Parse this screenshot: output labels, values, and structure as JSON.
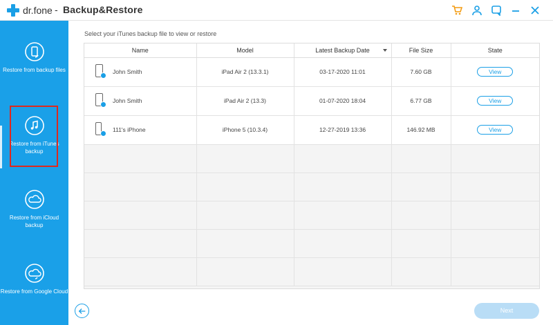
{
  "titlebar": {
    "brand": "dr.fone",
    "separator": "-",
    "title": "Backup&Restore",
    "icons": [
      "cart-icon",
      "user-icon",
      "feedback-icon",
      "minimize-icon",
      "close-icon"
    ]
  },
  "colors": {
    "accent": "#1aa0e8",
    "highlight": "#e0281c",
    "next_disabled": "#b9ddf6"
  },
  "sidebar": {
    "items": [
      {
        "label": "Restore from backup files",
        "icon": "phone-restore-icon"
      },
      {
        "label": "Restore from iTunes backup",
        "icon": "itunes-restore-icon",
        "active": true
      },
      {
        "label": "Restore from iCloud backup",
        "icon": "icloud-icon"
      },
      {
        "label": "Restore from Google Cloud",
        "icon": "google-cloud-icon"
      }
    ]
  },
  "main": {
    "instruction": "Select your iTunes backup file to view or restore",
    "columns": [
      "Name",
      "Model",
      "Latest Backup Date",
      "File Size",
      "State"
    ],
    "rows": [
      {
        "name": "John Smith",
        "model": "iPad Air 2 (13.3.1)",
        "date": "03-17-2020 11:01",
        "size": "7.60 GB",
        "state": "View"
      },
      {
        "name": "John Smith",
        "model": "iPad Air 2 (13.3)",
        "date": "01-07-2020 18:04",
        "size": "6.77 GB",
        "state": "View"
      },
      {
        "name": "111's iPhone",
        "model": "iPhone 5 (10.3.4)",
        "date": "12-27-2019 13:36",
        "size": "146.92 MB",
        "state": "View"
      }
    ]
  },
  "footer": {
    "next_label": "Next"
  }
}
